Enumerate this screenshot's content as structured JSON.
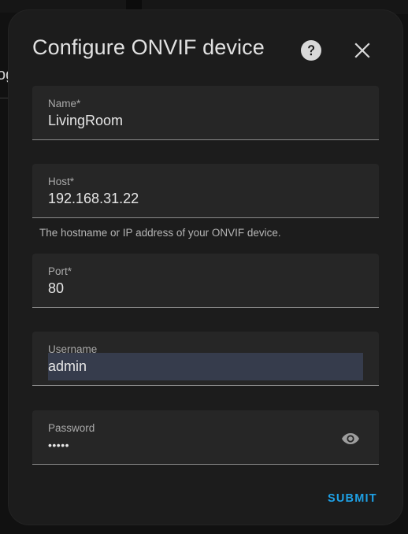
{
  "dialog": {
    "title": "Configure ONVIF device",
    "help_icon": "help-circle-icon",
    "close_icon": "close-icon"
  },
  "background": {
    "partial_text": "og"
  },
  "fields": {
    "name": {
      "label": "Name*",
      "value": "LivingRoom"
    },
    "host": {
      "label": "Host*",
      "value": "192.168.31.22",
      "helper": "The hostname or IP address of your ONVIF device."
    },
    "port": {
      "label": "Port*",
      "value": "80"
    },
    "username": {
      "label": "Username",
      "value": "admin"
    },
    "password": {
      "label": "Password",
      "value": "•••••",
      "toggle_icon": "eye-icon"
    }
  },
  "actions": {
    "submit_label": "SUBMIT"
  },
  "colors": {
    "accent": "#1ea1e6",
    "dialog_bg": "#1c1c1c",
    "field_bg": "#262626",
    "selection": "#363c4c"
  }
}
